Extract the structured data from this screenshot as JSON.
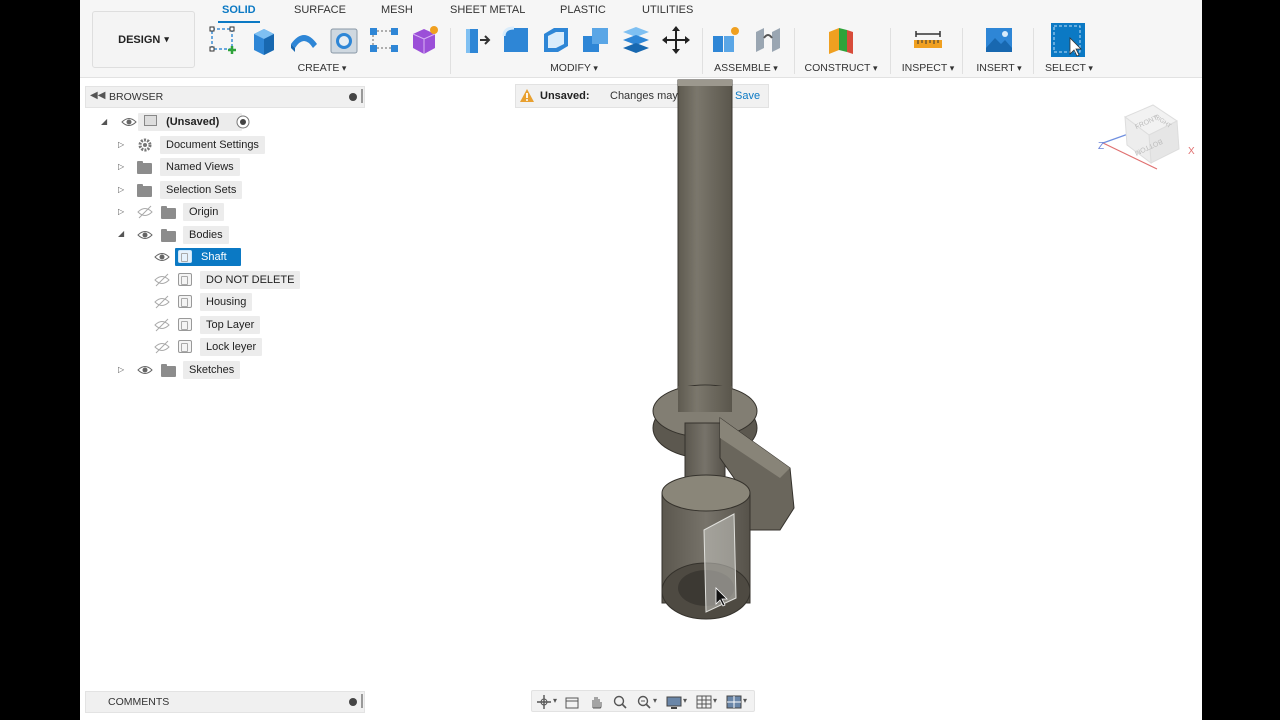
{
  "workspace": {
    "label": "DESIGN",
    "caret": "▾"
  },
  "tabs": [
    "SOLID",
    "SURFACE",
    "MESH",
    "SHEET METAL",
    "PLASTIC",
    "UTILITIES"
  ],
  "active_tab": "SOLID",
  "tool_groups": {
    "create": "CREATE",
    "modify": "MODIFY",
    "assemble": "ASSEMBLE",
    "construct": "CONSTRUCT",
    "inspect": "INSPECT",
    "insert": "INSERT",
    "select": "SELECT"
  },
  "browser": {
    "title": "BROWSER",
    "root": "(Unsaved)",
    "items": {
      "document_settings": "Document Settings",
      "named_views": "Named Views",
      "selection_sets": "Selection Sets",
      "origin": "Origin",
      "bodies": "Bodies",
      "sketches": "Sketches"
    },
    "bodies": [
      "Shaft",
      "DO NOT DELETE",
      "Housing",
      "Top Layer",
      "Lock leyer"
    ],
    "selected_body": "Shaft"
  },
  "unsaved_banner": {
    "label": "Unsaved:",
    "message": "Changes may be lost",
    "action": "Save"
  },
  "viewcube": {
    "front": "FRONT",
    "right": "RIGHT",
    "bottom": "BOTTOM",
    "axis_z": "Z",
    "axis_x": "X"
  },
  "comments": {
    "title": "COMMENTS"
  },
  "colors": {
    "accent": "#0b79c4",
    "model": "#6b675d",
    "warning": "#e8a030"
  },
  "icons": {
    "create": [
      "create-sketch-icon",
      "extrude-icon",
      "revolve-icon",
      "hole-icon",
      "pattern-icon",
      "create-form-icon"
    ],
    "modify": [
      "press-pull-icon",
      "fillet-icon",
      "shell-icon",
      "combine-icon",
      "offset-face-icon",
      "move-icon"
    ],
    "assemble": [
      "new-component-icon",
      "joint-icon"
    ],
    "construct": [
      "plane-icon"
    ],
    "inspect": [
      "measure-icon"
    ],
    "insert": [
      "insert-image-icon"
    ],
    "select": [
      "select-icon"
    ],
    "nav": [
      "orbit-icon",
      "look-at-icon",
      "pan-icon",
      "zoom-icon",
      "zoom-window-icon",
      "display-settings-icon",
      "grid-icon",
      "viewports-icon"
    ]
  }
}
